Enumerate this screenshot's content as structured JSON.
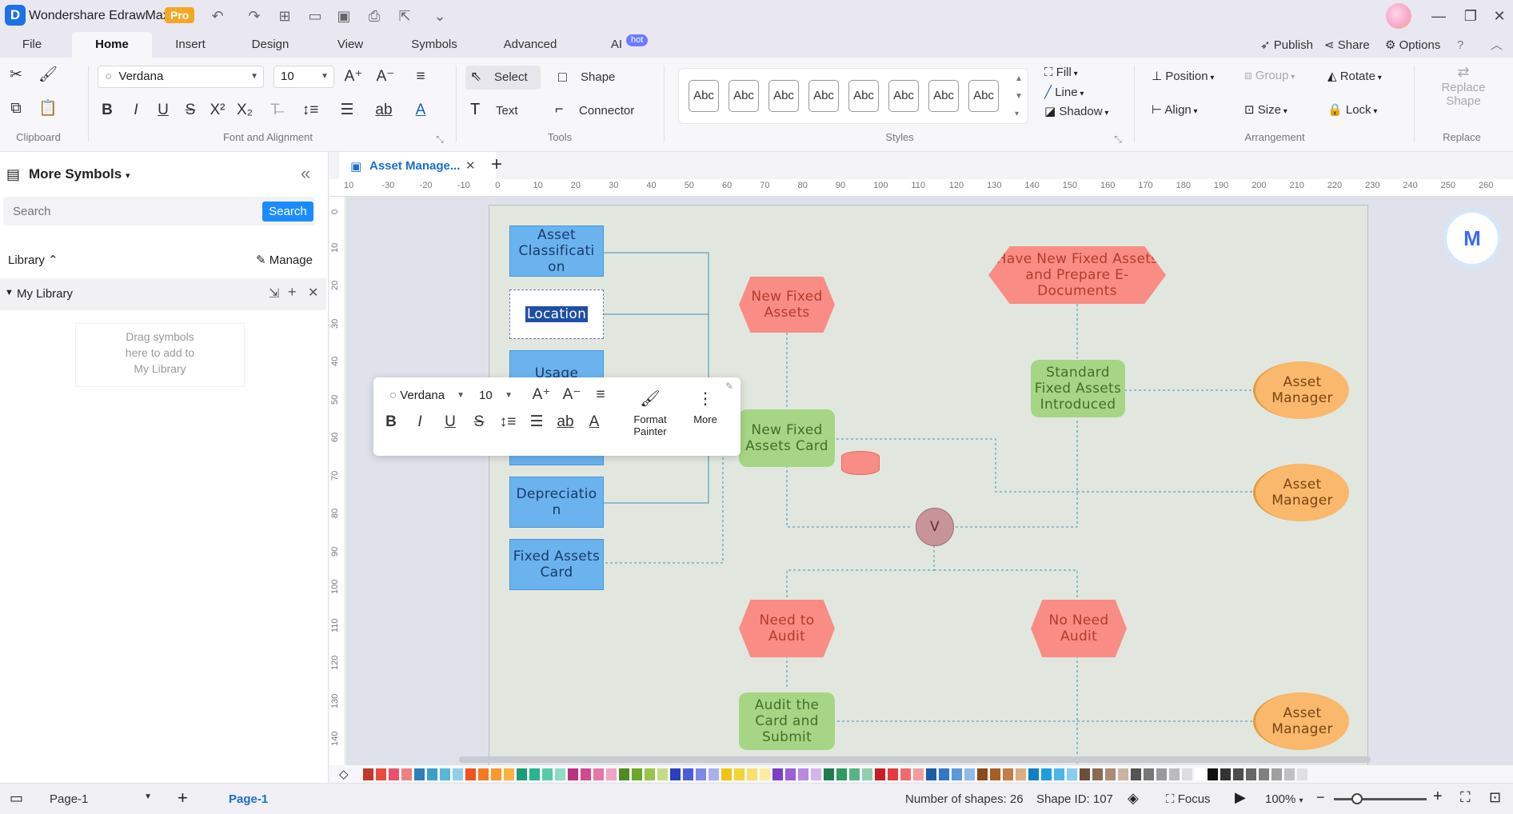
{
  "app": {
    "title": "Wondershare EdrawMax",
    "badge": "Pro"
  },
  "menu": {
    "tabs": [
      "File",
      "Home",
      "Insert",
      "Design",
      "View",
      "Symbols",
      "Advanced",
      "AI"
    ],
    "active": "Home",
    "ai_badge": "hot",
    "publish": "Publish",
    "share": "Share",
    "options": "Options"
  },
  "ribbon": {
    "font_family": "Verdana",
    "font_size": "10",
    "select": "Select",
    "shape": "Shape",
    "text": "Text",
    "connector": "Connector",
    "style_samples": [
      "Abc",
      "Abc",
      "Abc",
      "Abc",
      "Abc",
      "Abc",
      "Abc",
      "Abc"
    ],
    "fill": "Fill",
    "line": "Line",
    "shadow": "Shadow",
    "position": "Position",
    "group": "Group",
    "rotate": "Rotate",
    "align": "Align",
    "size": "Size",
    "lock": "Lock",
    "replace_shape_1": "Replace",
    "replace_shape_2": "Shape",
    "groups": {
      "clipboard": "Clipboard",
      "font": "Font and Alignment",
      "tools": "Tools",
      "styles": "Styles",
      "arrangement": "Arrangement",
      "replace": "Replace"
    }
  },
  "left_panel": {
    "title": "More Symbols",
    "search_placeholder": "Search",
    "search_button": "Search",
    "library": "Library",
    "manage": "Manage",
    "my_library": "My Library",
    "drag_hint_1": "Drag symbols",
    "drag_hint_2": "here to add to",
    "drag_hint_3": "My Library"
  },
  "document": {
    "tab_title": "Asset Manage..."
  },
  "rulers": {
    "h": [
      "10",
      "-30",
      "-20",
      "-10",
      "0",
      "10",
      "20",
      "30",
      "40",
      "50",
      "60",
      "70",
      "80",
      "90",
      "100",
      "110",
      "120",
      "130",
      "140",
      "150",
      "160",
      "170",
      "180",
      "190",
      "200",
      "210",
      "220",
      "230",
      "240",
      "250",
      "260"
    ],
    "v": [
      "0",
      "10",
      "20",
      "30",
      "40",
      "50",
      "60",
      "70",
      "80",
      "90",
      "100",
      "110",
      "120",
      "130",
      "140"
    ]
  },
  "diagram": {
    "asset_classification": "Asset Classificati on",
    "location": "Location",
    "usage": "Usage",
    "depreciation": "Depreciatio n",
    "fixed_assets_card": "Fixed Assets Card",
    "new_fixed_assets": "New Fixed Assets",
    "have_new": "Have New Fixed Assets and Prepare E-Documents",
    "standard": "Standard Fixed Assets Introduced",
    "asset_manager_1": "Asset Manager",
    "asset_manager_2": "Asset Manager",
    "asset_manager_3": "Asset Manager",
    "new_fixed_assets_card": "New Fixed Assets Card",
    "v": "V",
    "need_to_audit": "Need to Audit",
    "no_need_audit": "No Need Audit",
    "audit_card": "Audit the Card and Submit"
  },
  "float_toolbar": {
    "font_family": "Verdana",
    "font_size": "10",
    "format_painter_1": "Format",
    "format_painter_2": "Painter",
    "more": "More"
  },
  "status": {
    "page_select": "Page-1",
    "page_tab": "Page-1",
    "shapes": "Number of shapes: 26",
    "shape_id": "Shape ID: 107",
    "focus": "Focus",
    "zoom": "100%"
  },
  "palette": [
    "#c0392b",
    "#e74c3c",
    "#e8536b",
    "#f08080",
    "#2c7fb8",
    "#3aa0c8",
    "#58b7d8",
    "#8fd0e8",
    "#f2521b",
    "#f47a20",
    "#f79a2b",
    "#f9b041",
    "#1a9e7a",
    "#28b48f",
    "#58c9a9",
    "#8ddcc5",
    "#b83280",
    "#d3498e",
    "#e675a8",
    "#f0a3c6",
    "#4d8c1f",
    "#6aa82a",
    "#98c44a",
    "#c5dc87",
    "#2b3fbf",
    "#4a5ed8",
    "#7b8ae6",
    "#a8b2ee",
    "#f2c40f",
    "#f5d337",
    "#f8e06a",
    "#fbeca0",
    "#7d3fc7",
    "#9a5ed6",
    "#b889e3",
    "#d5b5ee",
    "#1e7d4c",
    "#2f9a62",
    "#5ab585",
    "#8fd0ac",
    "#c81d25",
    "#e33b3f",
    "#ee6b6d",
    "#f49c9d",
    "#1d5ca8",
    "#2f77c7",
    "#5c98dc",
    "#8fbbe9",
    "#8c4a19",
    "#a65e23",
    "#c27e45",
    "#dcac82",
    "#0d7fc2",
    "#209ddf",
    "#4db6e8",
    "#87cef0",
    "#6b4f3a",
    "#8a6a50",
    "#a88c74",
    "#c9b4a2",
    "#555555",
    "#777777",
    "#999999",
    "#bbbbbb",
    "#dddddd",
    "#ffffff",
    "#111111",
    "#333333",
    "#4d4d4d",
    "#666666",
    "#808080",
    "#a0a0a0",
    "#c0c0c0",
    "#e0e0e0"
  ]
}
